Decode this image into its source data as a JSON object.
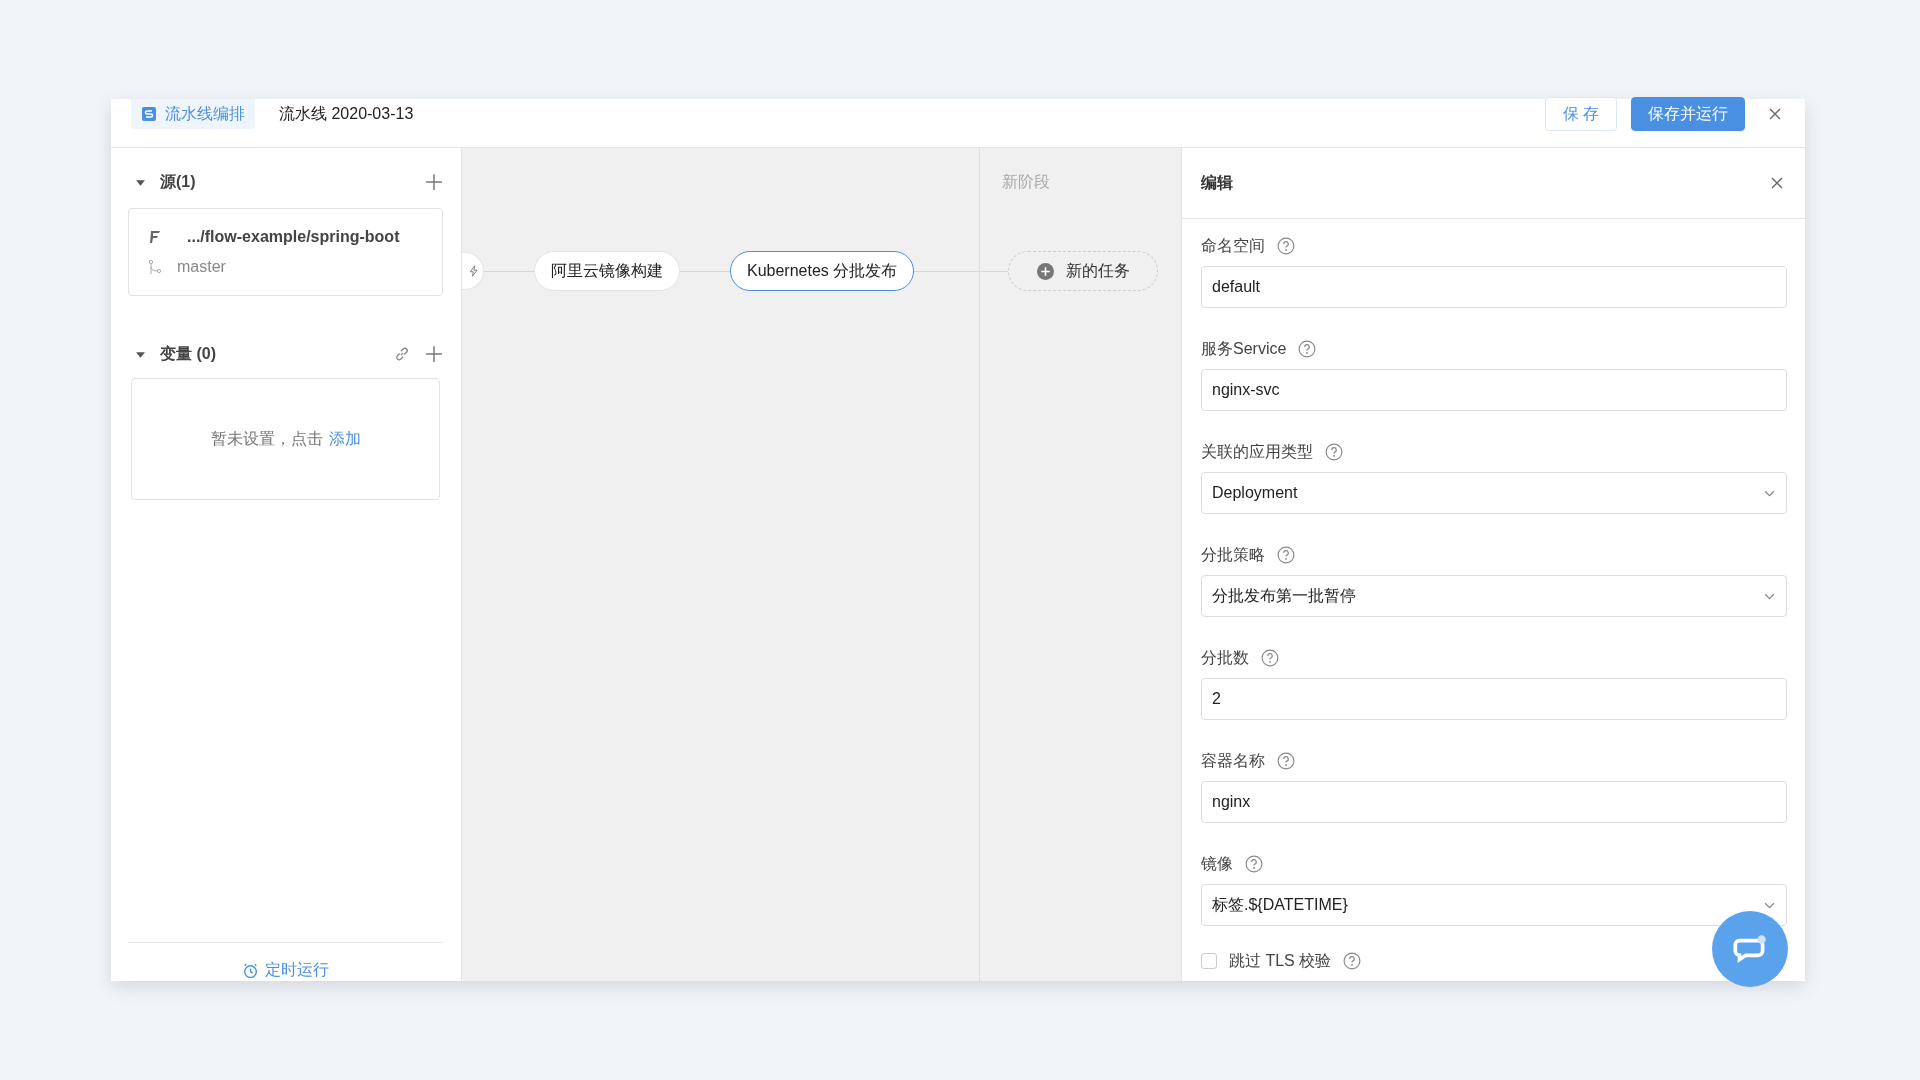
{
  "header": {
    "tab": {
      "label": "流水线编排",
      "selected": true
    },
    "title": "流水线 2020-03-13",
    "buttons": [
      {
        "label": "保 存",
        "kind": "secondary"
      },
      {
        "label": "保存并运行",
        "kind": "primary"
      }
    ]
  },
  "sidebar": {
    "sources": {
      "title": "源(1)",
      "expanded": true,
      "items": [
        {
          "path": ".../flow-example/spring-boot",
          "branch": "master"
        }
      ]
    },
    "variables": {
      "title": "变量 (0)",
      "expanded": true,
      "empty_text": "暂未设置，点击",
      "link": "添加"
    },
    "footer_link": "定时运行"
  },
  "canvas": {
    "tasks": [
      {
        "label": "阿里云镜像构建",
        "selected": false
      },
      {
        "label": "Kubernetes 分批发布",
        "selected": true
      }
    ],
    "new_stage": {
      "title": "新阶段",
      "add_task": "新的任务"
    }
  },
  "editor": {
    "title": "编辑",
    "fields": [
      {
        "kind": "input",
        "label": "命名空间",
        "value": "default"
      },
      {
        "kind": "input",
        "label": "服务Service",
        "value": "nginx-svc"
      },
      {
        "kind": "select",
        "label": "关联的应用类型",
        "value": "Deployment"
      },
      {
        "kind": "select",
        "label": "分批策略",
        "value": "分批发布第一批暂停"
      },
      {
        "kind": "input",
        "label": "分批数",
        "value": "2"
      },
      {
        "kind": "input",
        "label": "容器名称",
        "value": "nginx"
      },
      {
        "kind": "select",
        "label": "镜像",
        "value": "标签.${DATETIME}"
      },
      {
        "kind": "checkbox",
        "label": "跳过 TLS 校验",
        "checked": false
      }
    ]
  }
}
